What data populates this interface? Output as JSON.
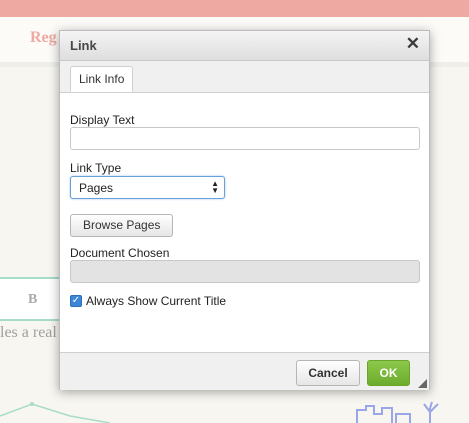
{
  "background": {
    "nav_text": "Reg",
    "card_label": "B",
    "body_text": "les a real"
  },
  "dialog": {
    "title": "Link",
    "close_symbol": "✕",
    "tabs": [
      {
        "label": "Link Info",
        "active": true
      }
    ],
    "display_text": {
      "label": "Display Text",
      "value": ""
    },
    "link_type": {
      "label": "Link Type",
      "selected": "Pages"
    },
    "browse_button": "Browse Pages",
    "document_chosen": {
      "label": "Document Chosen",
      "value": ""
    },
    "always_show_title": {
      "label": "Always Show Current Title",
      "checked": true
    },
    "footer": {
      "cancel_label": "Cancel",
      "ok_label": "OK"
    }
  },
  "colors": {
    "accent_pink": "#eeaaa2",
    "ok_green": "#7cb83a",
    "checkbox_blue": "#3b86d8"
  }
}
